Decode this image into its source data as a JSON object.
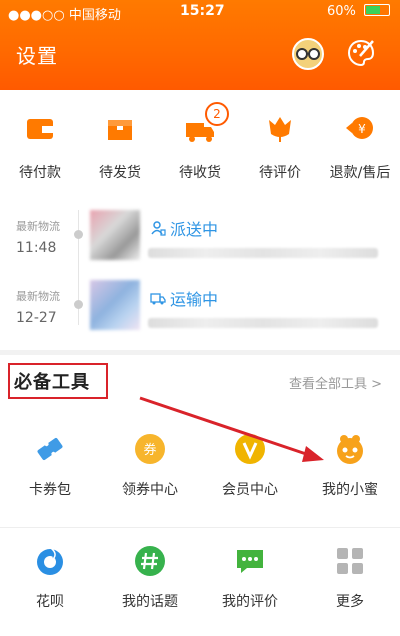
{
  "statusbar": {
    "carrier": "●●●○○ 中国移动",
    "time": "15:27",
    "battery": "60%"
  },
  "header": {
    "title": "设置"
  },
  "orders": [
    {
      "label": "待付款",
      "icon": "wallet-icon"
    },
    {
      "label": "待发货",
      "icon": "box-icon"
    },
    {
      "label": "待收货",
      "icon": "truck-icon",
      "badge": "2"
    },
    {
      "label": "待评价",
      "icon": "flower-icon"
    },
    {
      "label": "退款/售后",
      "icon": "refund-icon"
    }
  ],
  "logistics": [
    {
      "label": "最新物流",
      "time": "11:48",
      "status": "派送中",
      "icon": "courier-icon"
    },
    {
      "label": "最新物流",
      "time": "12-27",
      "status": "运输中",
      "icon": "van-icon"
    }
  ],
  "tools": {
    "title": "必备工具",
    "view_all": "查看全部工具 >",
    "items": [
      {
        "label": "卡券包",
        "icon": "ticket-icon"
      },
      {
        "label": "领券中心",
        "icon": "coupon-icon"
      },
      {
        "label": "会员中心",
        "icon": "vip-icon"
      },
      {
        "label": "我的小蜜",
        "icon": "assistant-icon"
      },
      {
        "label": "花呗",
        "icon": "huabei-icon"
      },
      {
        "label": "我的话题",
        "icon": "hashtag-icon"
      },
      {
        "label": "我的评价",
        "icon": "chat-icon"
      },
      {
        "label": "更多",
        "icon": "grid-icon"
      }
    ]
  },
  "colors": {
    "brand": "#ff6a00",
    "status_blue": "#2f95e4",
    "highlight": "#d9232a"
  }
}
